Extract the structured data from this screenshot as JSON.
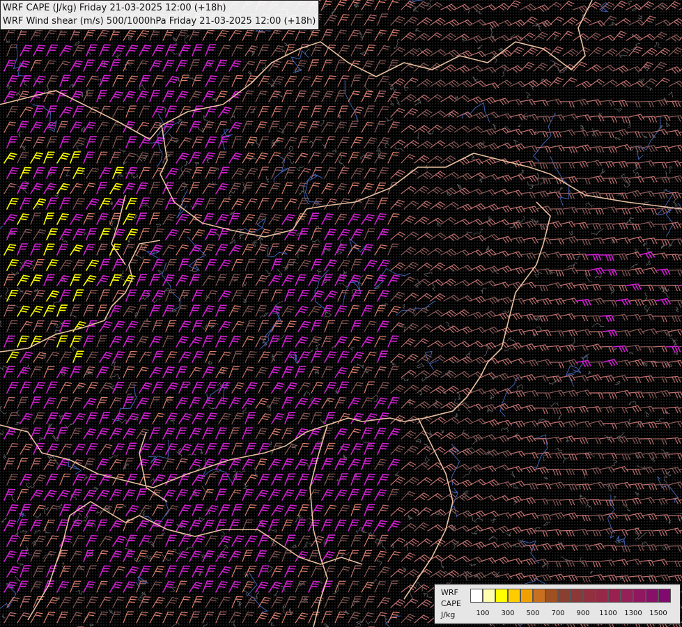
{
  "title": {
    "line1": "WRF CAPE (J/kg) Friday 21-03-2025 12:00 (+18h)",
    "line2": "WRF Wind shear (m/s) 500/1000hPa Friday 21-03-2025 12:00 (+18h)"
  },
  "legend": {
    "label_line1": "WRF",
    "label_line2": "CAPE",
    "label_line3": "J/kg",
    "ticks": [
      "100",
      "300",
      "500",
      "700",
      "900",
      "1100",
      "1300",
      "1500"
    ],
    "colors": [
      "#ffffff",
      "#ffffb0",
      "#ffff00",
      "#ffcc00",
      "#f0a000",
      "#c87020",
      "#a05020",
      "#8a4030",
      "#8c3838",
      "#923040",
      "#982848",
      "#9a2050",
      "#962058",
      "#901860",
      "#881068",
      "#800a70"
    ]
  },
  "barb_colors": {
    "low": "#8a5a58",
    "mid": "#c07070",
    "salmon": "#e08070",
    "magenta": "#d020d0",
    "yellow": "#ffff00"
  },
  "map_colors": {
    "border": "#e8c0a0",
    "river": "#4060b0",
    "terrain": "#606060"
  }
}
